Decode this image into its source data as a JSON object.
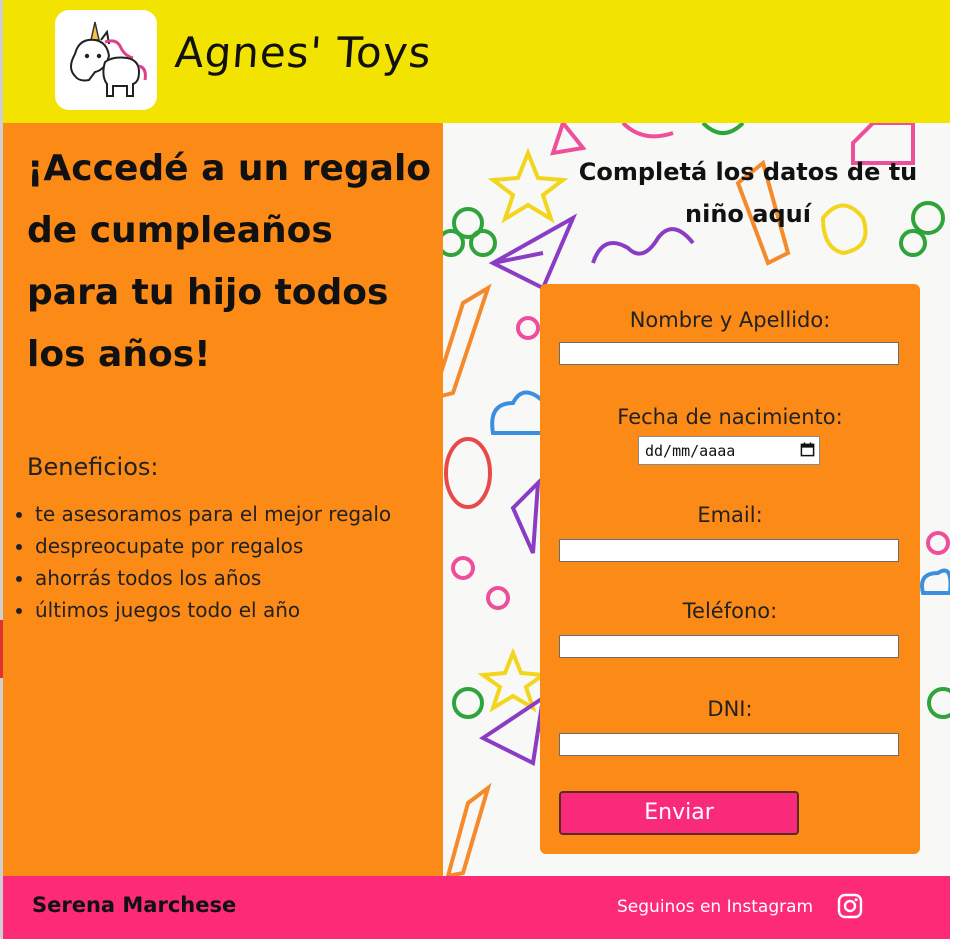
{
  "header": {
    "brand": "Agnes' Toys",
    "logo_icon": "unicorn-icon"
  },
  "hero": {
    "headline": "¡Accedé a un regalo de cumpleaños para tu hijo todos los años!",
    "benefits_title": "Beneficios:",
    "benefits": [
      "te asesoramos para el mejor regalo",
      "despreocupate por regalos",
      "ahorrás todos los años",
      "últimos juegos todo el año"
    ]
  },
  "form": {
    "title": "Completá los datos de tu niño aquí",
    "name_label": "Nombre y Apellido:",
    "birth_label": "Fecha de nacimiento:",
    "birth_placeholder": "dd/mm/aaaa",
    "email_label": "Email:",
    "phone_label": "Teléfono:",
    "dni_label": "DNI:",
    "submit_label": "Enviar"
  },
  "footer": {
    "author": "Serena Marchese",
    "follow_text": "Seguinos en Instagram",
    "icon": "instagram-icon"
  },
  "colors": {
    "header_bg": "#f2e400",
    "panel_bg": "#fc8a17",
    "footer_bg": "#fc2a77",
    "button_bg": "#fa2a7b"
  }
}
